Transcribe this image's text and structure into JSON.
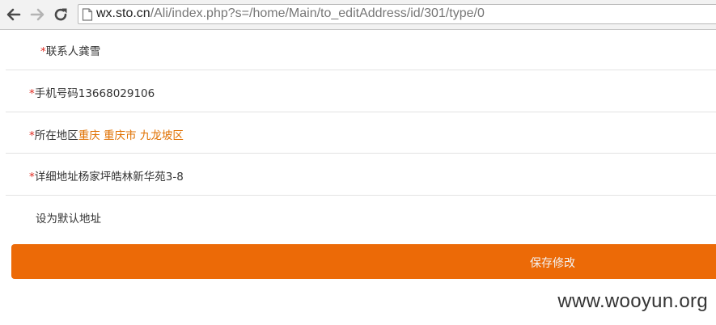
{
  "browser": {
    "url_host": "wx.sto.cn",
    "url_path": "/Ali/index.php?s=/home/Main/to_editAddress/id/301/type/0"
  },
  "form": {
    "required_mark": "*",
    "contact": {
      "label": "联系人",
      "value": "龚雪"
    },
    "phone": {
      "label": "手机号码",
      "value": "13668029106"
    },
    "region": {
      "label": "所在地区",
      "value": "重庆 重庆市 九龙坡区"
    },
    "address": {
      "label": "详细地址",
      "value": "杨家坪皓林新华苑3-8"
    },
    "default_label": "设为默认地址",
    "save_label": "保存修改"
  },
  "watermark": "www.wooyun.org",
  "colors": {
    "accent": "#ec6a07",
    "required": "#e0281f",
    "region_text": "#e07000"
  }
}
